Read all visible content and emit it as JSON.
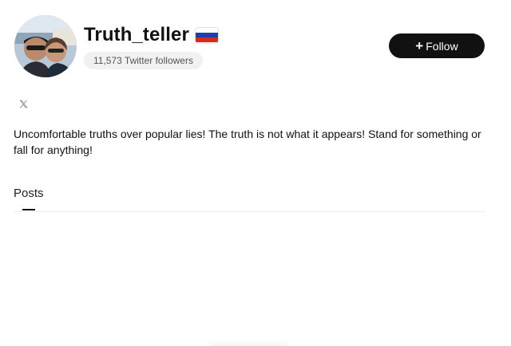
{
  "profile": {
    "name": "Truth_teller",
    "followers": "11,573 Twitter followers",
    "bio": "Uncomfortable truths over popular lies! The truth is not what it appears! Stand for something or fall for anything!"
  },
  "actions": {
    "follow_label": "Follow",
    "follow_icon": "plus-icon"
  },
  "social": {
    "x_icon": "x-logo-icon"
  },
  "tabs": [
    {
      "label": "Posts",
      "active": true
    }
  ],
  "colors": {
    "button_bg": "#111111",
    "badge_bg": "#f1f1f1",
    "flag": [
      "#ffffff",
      "#1c3fa8",
      "#d52b1e"
    ]
  }
}
